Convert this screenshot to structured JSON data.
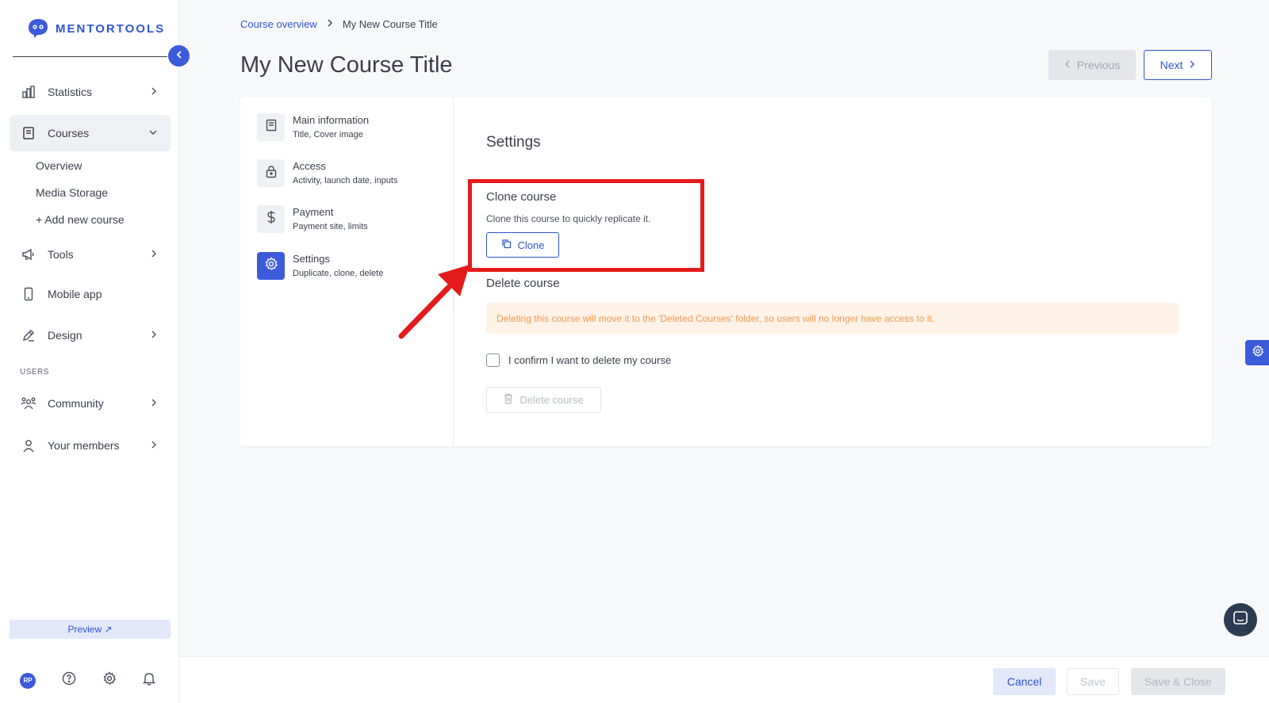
{
  "app": {
    "brand": "MENTORTOOLS"
  },
  "sidebar": {
    "items": [
      {
        "label": "Statistics"
      },
      {
        "label": "Courses"
      },
      {
        "label": "Tools"
      },
      {
        "label": "Mobile app"
      },
      {
        "label": "Design"
      },
      {
        "label": "Community"
      },
      {
        "label": "Your members"
      }
    ],
    "courses_sub": [
      "Overview",
      "Media Storage",
      "+ Add new course"
    ],
    "section_users": "USERS",
    "preview": "Preview ↗",
    "avatar_initials": "RP"
  },
  "breadcrumb": {
    "parent": "Course overview",
    "current": "My New Course Title"
  },
  "page": {
    "title": "My New Course Title"
  },
  "pager": {
    "previous": "Previous",
    "next": "Next"
  },
  "steps": [
    {
      "title": "Main information",
      "subtitle": "Title, Cover image"
    },
    {
      "title": "Access",
      "subtitle": "Activity, launch date, inputs"
    },
    {
      "title": "Payment",
      "subtitle": "Payment site, limits"
    },
    {
      "title": "Settings",
      "subtitle": "Duplicate, clone, delete"
    }
  ],
  "settings": {
    "title": "Settings",
    "clone_title": "Clone course",
    "clone_desc": "Clone this course to quickly replicate it.",
    "clone_button": "Clone",
    "delete_title": "Delete course",
    "delete_warning": "Deleting this course will move it to the 'Deleted Courses' folder, so users will no longer have access to it.",
    "confirm_label": "I confirm I want to delete my course",
    "delete_button": "Delete course"
  },
  "footer": {
    "cancel": "Cancel",
    "save": "Save",
    "save_close": "Save & Close"
  },
  "colors": {
    "accent": "#3b5bdb",
    "annotation": "#e41b1b",
    "warning_text": "#f2994a"
  }
}
